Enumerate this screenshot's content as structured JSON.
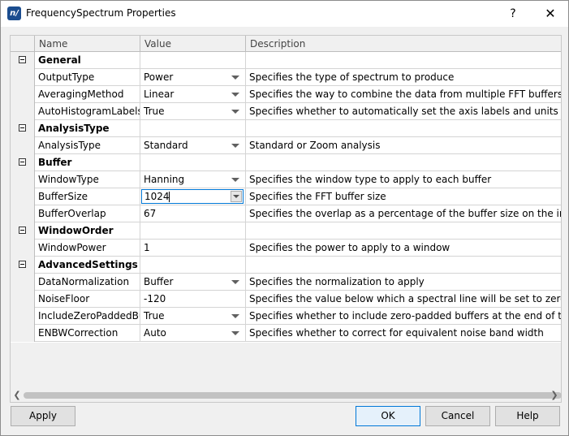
{
  "window": {
    "title": "FrequencySpectrum Properties",
    "app_icon_text": "n/",
    "help_label": "?",
    "close_label": "✕"
  },
  "grid": {
    "columns": [
      "Name",
      "Value",
      "Description"
    ],
    "rows": [
      {
        "type": "category",
        "name": "General"
      },
      {
        "type": "prop",
        "name": "OutputType",
        "value": "Power",
        "dropdown": true,
        "description": "Specifies the type of spectrum to produce"
      },
      {
        "type": "prop",
        "name": "AveragingMethod",
        "value": "Linear",
        "dropdown": true,
        "description": "Specifies the way to combine the data from multiple FFT buffers"
      },
      {
        "type": "prop",
        "name": "AutoHistogramLabels",
        "value": "True",
        "dropdown": true,
        "description": "Specifies whether to automatically set the axis labels and units text or"
      },
      {
        "type": "category",
        "name": "AnalysisType"
      },
      {
        "type": "prop",
        "name": "AnalysisType",
        "value": "Standard",
        "dropdown": true,
        "description": "Standard or Zoom analysis"
      },
      {
        "type": "category",
        "name": "Buffer"
      },
      {
        "type": "prop",
        "name": "WindowType",
        "value": "Hanning",
        "dropdown": true,
        "description": "Specifies the window type to apply to each buffer"
      },
      {
        "type": "prop",
        "name": "BufferSize",
        "value": "1024",
        "editing": true,
        "description": "Specifies the FFT buffer size"
      },
      {
        "type": "prop",
        "name": "BufferOverlap",
        "value": "67",
        "dropdown": false,
        "description": "Specifies the overlap as a percentage of the buffer size on the input d"
      },
      {
        "type": "category",
        "name": "WindowOrder"
      },
      {
        "type": "prop",
        "name": "WindowPower",
        "value": "1",
        "dropdown": false,
        "description": "Specifies the power to apply to a window"
      },
      {
        "type": "category",
        "name": "AdvancedSettings"
      },
      {
        "type": "prop",
        "name": "DataNormalization",
        "value": "Buffer",
        "dropdown": true,
        "description": "Specifies the normalization to apply"
      },
      {
        "type": "prop",
        "name": "NoiseFloor",
        "value": "-120",
        "dropdown": false,
        "description": "Specifies the value below which a spectral line will be set to zero (dB)"
      },
      {
        "type": "prop",
        "name": "IncludeZeroPaddedBuffers",
        "value": "True",
        "dropdown": true,
        "description": "Specifies whether to include zero-padded buffers at the end of the sig"
      },
      {
        "type": "prop",
        "name": "ENBWCorrection",
        "value": "Auto",
        "dropdown": true,
        "description": "Specifies whether to correct for equivalent noise band width"
      }
    ]
  },
  "scrollbar": {
    "left_arrow": "❮",
    "right_arrow": "❯"
  },
  "buttons": {
    "apply": "Apply",
    "ok": "OK",
    "cancel": "Cancel",
    "help": "Help"
  }
}
